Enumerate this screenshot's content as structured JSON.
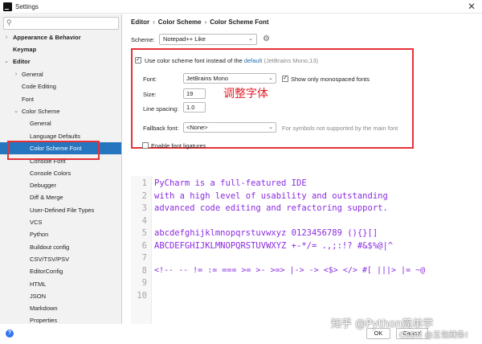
{
  "window": {
    "title": "Settings",
    "close_glyph": "✕"
  },
  "sidebar": {
    "search_placeholder": "",
    "search_icon": "search-icon",
    "items": [
      {
        "label": "Appearance & Behavior",
        "arrow": "›"
      },
      {
        "label": "Keymap",
        "arrow": ""
      },
      {
        "label": "Editor",
        "arrow": "⌄"
      },
      {
        "label": "General",
        "arrow": "›"
      },
      {
        "label": "Code Editing",
        "arrow": ""
      },
      {
        "label": "Font",
        "arrow": ""
      },
      {
        "label": "Color Scheme",
        "arrow": "⌄"
      },
      {
        "label": "General",
        "arrow": ""
      },
      {
        "label": "Language Defaults",
        "arrow": ""
      },
      {
        "label": "Color Scheme Font",
        "arrow": ""
      },
      {
        "label": "Console Font",
        "arrow": ""
      },
      {
        "label": "Console Colors",
        "arrow": ""
      },
      {
        "label": "Debugger",
        "arrow": ""
      },
      {
        "label": "Diff & Merge",
        "arrow": ""
      },
      {
        "label": "User-Defined File Types",
        "arrow": ""
      },
      {
        "label": "VCS",
        "arrow": ""
      },
      {
        "label": "Python",
        "arrow": ""
      },
      {
        "label": "Buildout config",
        "arrow": ""
      },
      {
        "label": "CSV/TSV/PSV",
        "arrow": ""
      },
      {
        "label": "EditorConfig",
        "arrow": ""
      },
      {
        "label": "HTML",
        "arrow": ""
      },
      {
        "label": "JSON",
        "arrow": ""
      },
      {
        "label": "Markdown",
        "arrow": ""
      },
      {
        "label": "Properties",
        "arrow": ""
      }
    ],
    "help_glyph": "?"
  },
  "breadcrumb": {
    "items": [
      "Editor",
      "Color Scheme",
      "Color Scheme Font"
    ],
    "separator": "›"
  },
  "scheme": {
    "label": "Scheme:",
    "value": "Notepad++ Like",
    "chevron": "⌄"
  },
  "font_settings": {
    "use_scheme_font": {
      "checked_glyph": "✓",
      "label_prefix": "Use color scheme font instead of the",
      "link": "default",
      "hint": "(JetBrains Mono,13)"
    },
    "font_label": "Font:",
    "font_value": "JetBrains Mono",
    "monospaced_label": "Show only monospaced fonts",
    "size_label": "Size:",
    "size_value": "19",
    "spacing_label": "Line spacing:",
    "spacing_value": "1.0",
    "fallback_label": "Fallback font:",
    "fallback_value": "<None>",
    "fallback_hint": "For symbols not supported by the main font",
    "ligatures_label": "Enable font ligatures"
  },
  "annotation": {
    "text": "调整字体",
    "color": "#e0202a"
  },
  "preview": {
    "lines": [
      {
        "num": "1",
        "text": "PyCharm is a full-featured IDE"
      },
      {
        "num": "2",
        "text": "with a high level of usability and outstanding"
      },
      {
        "num": "3",
        "text": "advanced code editing and refactoring support."
      },
      {
        "num": "4",
        "text": ""
      },
      {
        "num": "5",
        "text": "abcdefghijklmnopqrstuvwxyz 0123456789 (){}[]"
      },
      {
        "num": "6",
        "text": "ABCDEFGHIJKLMNOPQRSTUVWXYZ +-*/= .,;:!? #&$%@|^"
      },
      {
        "num": "7",
        "text": ""
      },
      {
        "num": "8",
        "text": "<!-- -- != := === >= >- >=> |-> -> <$> </> #[ |||> |= ~@"
      },
      {
        "num": "9",
        "text": ""
      },
      {
        "num": "10",
        "text": ""
      }
    ],
    "text_color": "#8a2be2"
  },
  "footer": {
    "ok_label": "OK",
    "cancel_label": "Cancel",
    "watermark_1": "知乎 @Python简单学",
    "watermark_2": "CSDN @五包辣条!"
  },
  "colors": {
    "selection": "#2675bf",
    "highlight_box": "#e53238",
    "link": "#2470b3"
  }
}
